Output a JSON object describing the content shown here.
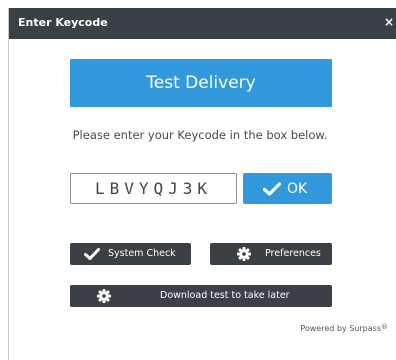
{
  "dialog": {
    "title": "Enter Keycode",
    "close_label": "×"
  },
  "banner": {
    "text": "Test Delivery"
  },
  "instruction": "Please enter your Keycode in the box below.",
  "keycode": {
    "value": "LBVYQJ3K",
    "placeholder": ""
  },
  "buttons": {
    "ok_label": "OK",
    "system_check_label": "System Check",
    "preferences_label": "Preferences",
    "download_label": "Download test to take later"
  },
  "footer": {
    "powered_by": "Powered by Surpass",
    "registered_mark": "®"
  },
  "colors": {
    "accent": "#3399dd",
    "dark": "#3a4046"
  },
  "icons": [
    "close-icon",
    "checkmark-icon",
    "gear-icon"
  ]
}
